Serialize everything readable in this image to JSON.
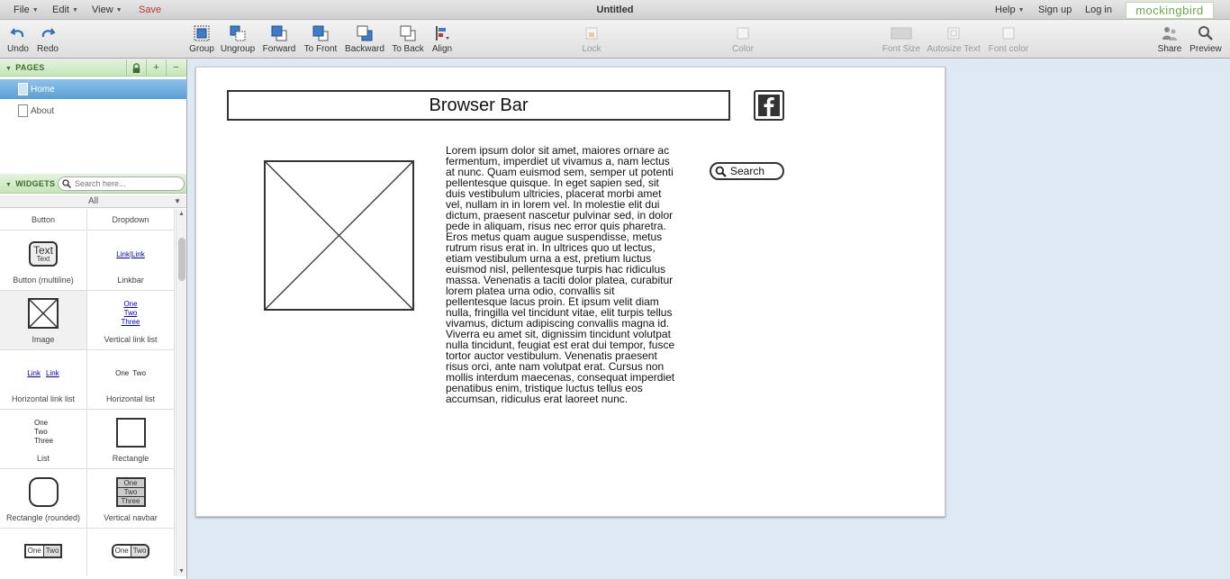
{
  "app": {
    "title": "Untitled",
    "logo": "mockingbird",
    "accent_color": "#6aa84f",
    "save_color": "#c0392b"
  },
  "menu": {
    "file": "File",
    "edit": "Edit",
    "view": "View",
    "save": "Save",
    "help": "Help",
    "signup": "Sign up",
    "login": "Log in"
  },
  "toolbar": {
    "undo": "Undo",
    "redo": "Redo",
    "group": "Group",
    "ungroup": "Ungroup",
    "forward": "Forward",
    "to_front": "To Front",
    "backward": "Backward",
    "to_back": "To Back",
    "align": "Align",
    "lock": "Lock",
    "color": "Color",
    "font_size": "Font Size",
    "autosize_text": "Autosize Text",
    "font_color": "Font color",
    "share": "Share",
    "preview": "Preview"
  },
  "pages": {
    "header": "PAGES",
    "items": [
      {
        "label": "Home",
        "selected": true
      },
      {
        "label": "About",
        "selected": false
      }
    ]
  },
  "widgets": {
    "header": "WIDGETS",
    "search_placeholder": "Search here...",
    "filter": "All",
    "items": [
      {
        "label": "Button"
      },
      {
        "label": "Dropdown"
      },
      {
        "label": "Button (multiline)",
        "preview": [
          "Text",
          "Text"
        ]
      },
      {
        "label": "Linkbar",
        "preview": [
          "Link",
          "Link"
        ]
      },
      {
        "label": "Image"
      },
      {
        "label": "Vertical link list",
        "preview": [
          "One",
          "Two",
          "Three"
        ]
      },
      {
        "label": "Horizontal link list",
        "preview": [
          "Link",
          "Link"
        ]
      },
      {
        "label": "Horizontal list",
        "preview": [
          "One",
          "Two"
        ]
      },
      {
        "label": "List",
        "preview": [
          "One",
          "Two",
          "Three"
        ]
      },
      {
        "label": "Rectangle"
      },
      {
        "label": "Rectangle (rounded)"
      },
      {
        "label": "Vertical navbar",
        "preview": [
          "One",
          "Two",
          "Three"
        ]
      },
      {
        "label": "",
        "preview": [
          "One",
          "Two"
        ]
      },
      {
        "label": "",
        "preview": [
          "One",
          "Two"
        ]
      }
    ]
  },
  "canvas": {
    "browser_bar": "Browser Bar",
    "lorem": "Lorem ipsum dolor sit amet, maiores ornare ac fermentum, imperdiet ut vivamus a, nam lectus at nunc. Quam euismod sem, semper ut potenti pellentesque quisque. In eget sapien sed, sit duis vestibulum ultricies, placerat morbi amet vel, nullam in in lorem vel. In molestie elit dui dictum, praesent nascetur pulvinar sed, in dolor pede in aliquam, risus nec error quis pharetra. Eros metus quam augue suspendisse, metus rutrum risus erat in.  In ultrices quo ut lectus, etiam vestibulum urna a est, pretium luctus euismod nisl, pellentesque turpis hac ridiculus massa. Venenatis a taciti dolor platea, curabitur lorem platea urna odio, convallis sit pellentesque lacus proin. Et ipsum velit diam nulla, fringilla vel tincidunt vitae, elit turpis tellus vivamus, dictum adipiscing convallis magna id. Viverra eu amet sit, dignissim tincidunt volutpat nulla tincidunt, feugiat est erat dui tempor, fusce tortor auctor vestibulum. Venenatis praesent risus orci, ante nam volutpat erat. Cursus non mollis interdum maecenas, consequat imperdiet penatibus enim, tristique luctus tellus eos accumsan, ridiculus erat laoreet nunc.",
    "search": "Search"
  }
}
